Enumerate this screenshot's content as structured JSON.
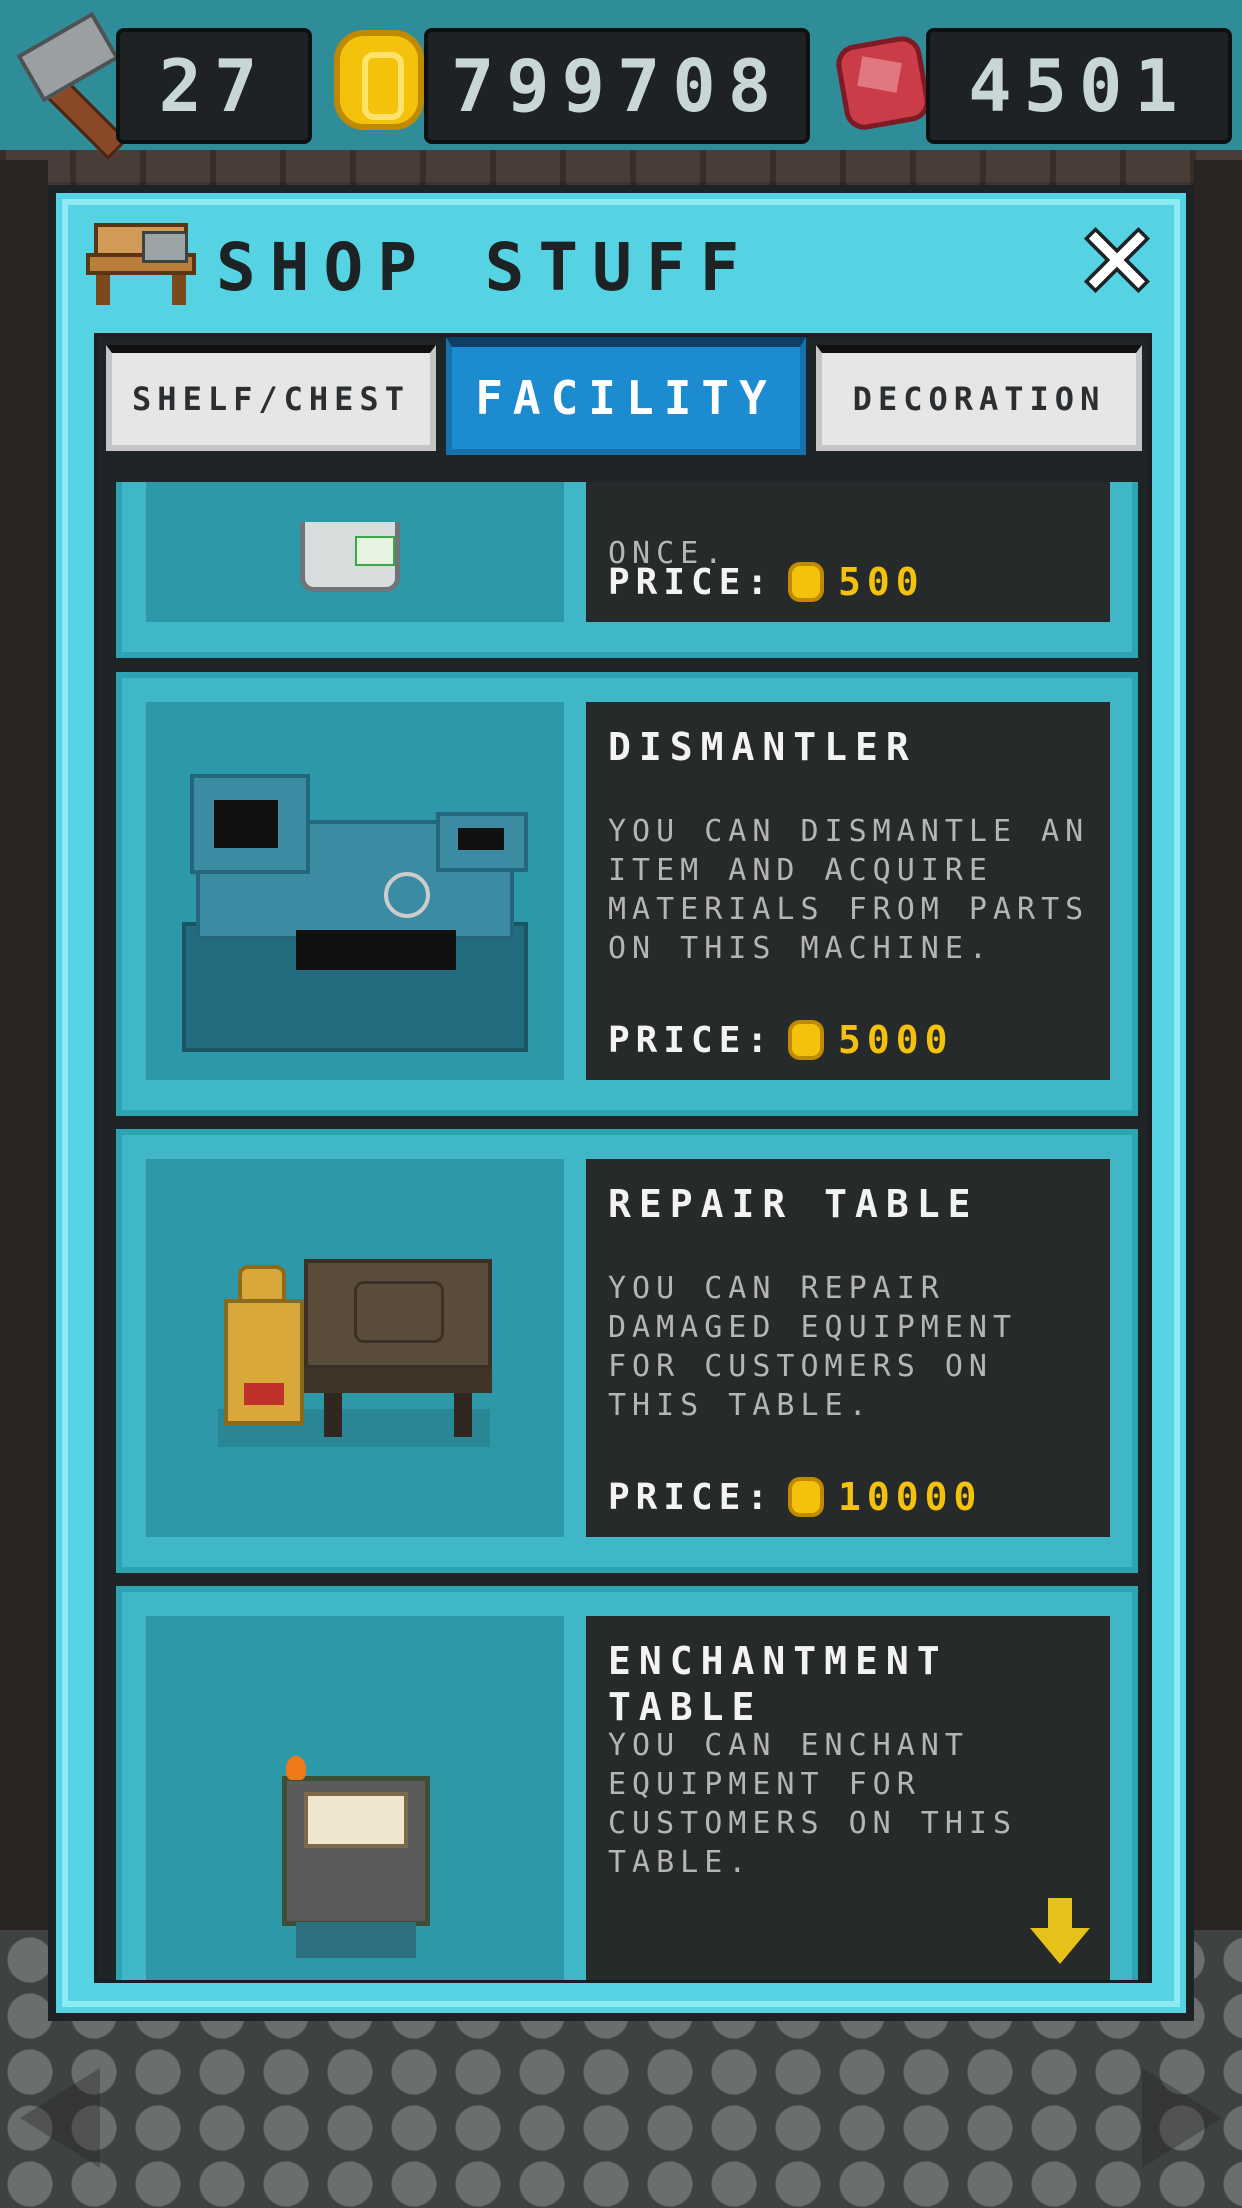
{
  "hud": {
    "hammers": "27",
    "coins": "799708",
    "gems": "4501"
  },
  "modal": {
    "title": "SHOP STUFF",
    "close_icon": "close-icon"
  },
  "tabs": [
    {
      "label": "SHELF/CHEST",
      "active": false
    },
    {
      "label": "FACILITY",
      "active": true
    },
    {
      "label": "DECORATION",
      "active": false
    }
  ],
  "items": [
    {
      "name": "",
      "description": "ONCE.",
      "price_label": "PRICE:",
      "price": "500"
    },
    {
      "name": "DISMANTLER",
      "description": "YOU CAN DISMANTLE AN ITEM AND ACQUIRE MATERIALS FROM PARTS ON THIS MACHINE.",
      "price_label": "PRICE:",
      "price": "5000"
    },
    {
      "name": "REPAIR TABLE",
      "description": "YOU CAN REPAIR DAMAGED EQUIPMENT FOR CUSTOMERS ON THIS TABLE.",
      "price_label": "PRICE:",
      "price": "10000"
    },
    {
      "name": "ENCHANTMENT TABLE",
      "description": "YOU CAN ENCHANT EQUIPMENT FOR CUSTOMERS ON THIS TABLE.",
      "price_label": "",
      "price": ""
    }
  ],
  "colors": {
    "accent": "#56d3e2",
    "active_tab": "#1c8bd0",
    "price": "#f4c20d"
  }
}
